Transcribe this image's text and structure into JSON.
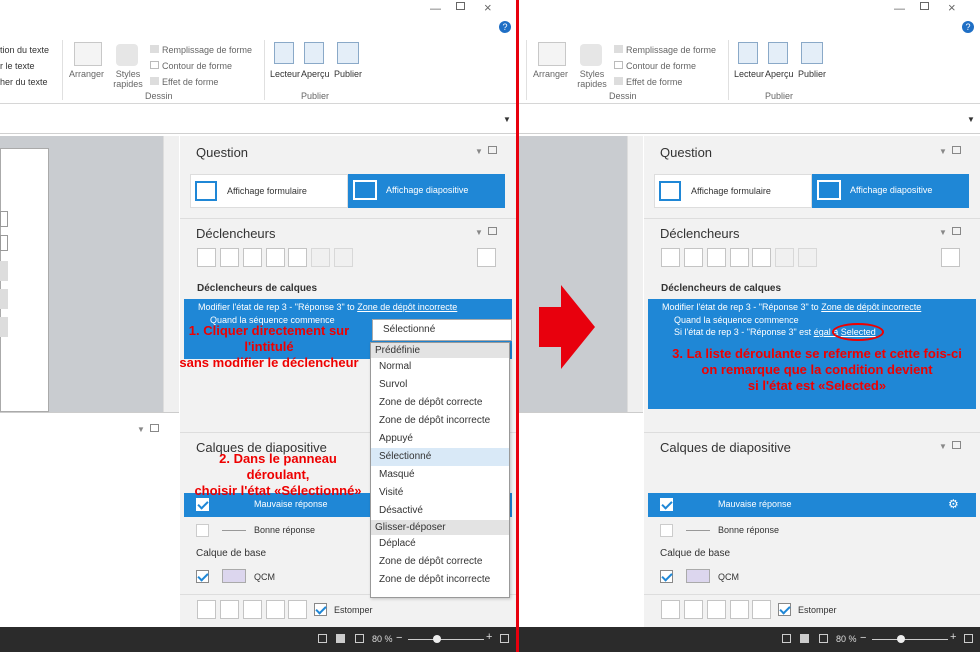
{
  "ribbon": {
    "left_items": [
      "tion du texte",
      "r le texte",
      "her du texte"
    ],
    "arrange": "Arranger",
    "styles": "Styles rapides",
    "fill": "Remplissage de forme",
    "outline": "Contour de forme",
    "effect": "Effet de forme",
    "group_drawing": "Dessin",
    "reader": "Lecteur",
    "preview": "Aperçu",
    "publish": "Publier",
    "group_publish": "Publier"
  },
  "question": {
    "title": "Question",
    "form_view": "Affichage formulaire",
    "slide_view": "Affichage diapositive"
  },
  "triggers": {
    "title": "Déclencheurs",
    "layer_triggers": "Déclencheurs de calques",
    "line1_prefix": "Modifier l'état de rep 3 - \"Réponse 3\" to ",
    "line1_link": "Zone de dépôt incorrecte",
    "line2": "Quand la séquence commence",
    "line3_prefix": "Si l'état de rep 3 - \"Réponse 3\" est ",
    "line3_link1": "égal à",
    "line3_link2": "Selected",
    "dropdown_value": "Sélectionné"
  },
  "dropdown": {
    "group1": "Prédéfinie",
    "items1": [
      "Normal",
      "Survol",
      "Zone de dépôt correcte",
      "Zone de dépôt incorrecte",
      "Appuyé",
      "Sélectionné",
      "Masqué",
      "Visité",
      "Désactivé"
    ],
    "group2": "Glisser-déposer",
    "items2": [
      "Déplacé",
      "Zone de dépôt correcte",
      "Zone de dépôt incorrecte"
    ]
  },
  "layers": {
    "title": "Calques de diapositive",
    "layer1": "Mauvaise réponse",
    "layer2": "Bonne réponse",
    "base_title": "Calque de base",
    "base_layer": "QCM",
    "fade": "Estomper"
  },
  "status": {
    "zoom": "80 %"
  },
  "annotations": {
    "a1_line1": "1. Cliquer directement sur l'intitulé",
    "a1_line2": "sans modifier  le déclencheur",
    "a2_line1": "2. Dans le panneau déroulant,",
    "a2_line2": "choisir l'état «Sélectionné»",
    "a3_line1": "3. La liste déroulante se referme et cette fois-ci",
    "a3_line2": "on remarque que la condition devient",
    "a3_line3": "si l'état est  «Selected»"
  },
  "colors": {
    "accent": "#1f87d6",
    "annotation": "#e00000",
    "divider": "#e8000d"
  }
}
